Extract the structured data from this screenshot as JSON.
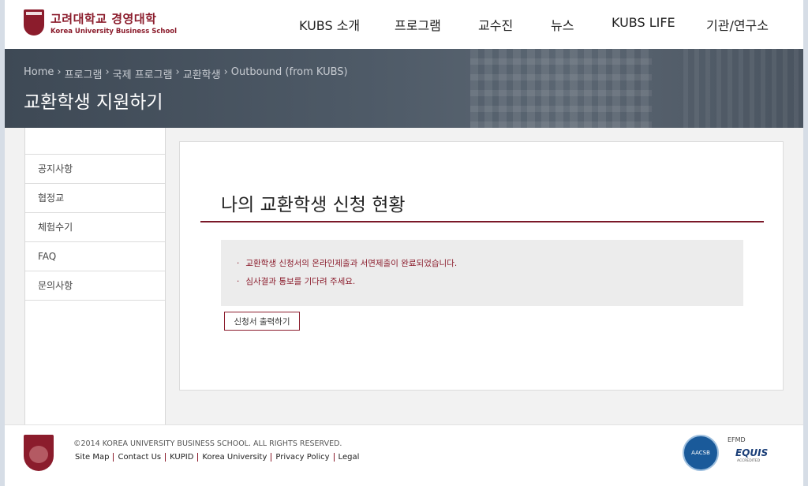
{
  "header": {
    "logo_kr": "고려대학교 경영대학",
    "logo_en": "Korea University Business School",
    "nav": [
      {
        "label": "KUBS 소개"
      },
      {
        "label": "프로그램"
      },
      {
        "label": "교수진"
      },
      {
        "label": "뉴스"
      },
      {
        "label": "KUBS LIFE"
      },
      {
        "label": "기관/연구소"
      }
    ]
  },
  "banner": {
    "breadcrumb": [
      "Home",
      "프로그램",
      "국제 프로그램",
      "교환학생",
      "Outbound (from KUBS)"
    ],
    "title": "교환학생 지원하기"
  },
  "sidebar": {
    "items": [
      {
        "label": "공지사항"
      },
      {
        "label": "협정교"
      },
      {
        "label": "체험수기"
      },
      {
        "label": "FAQ"
      },
      {
        "label": "문의사항"
      }
    ]
  },
  "main": {
    "title": "나의 교환학생 신청 현황",
    "notices": [
      "교환학생 신청서의 온라인제출과 서면제출이 완료되었습니다.",
      "심사결과 통보를 기다려 주세요."
    ],
    "print_button": "신청서 출력하기"
  },
  "footer": {
    "copyright": "©2014 KOREA UNIVERSITY BUSINESS SCHOOL. ALL RIGHTS RESERVED.",
    "links": [
      {
        "label": "Site Map"
      },
      {
        "label": "Contact Us"
      },
      {
        "label": "KUPID"
      },
      {
        "label": "Korea University"
      },
      {
        "label": "Privacy Policy"
      },
      {
        "label": "Legal"
      }
    ],
    "aacsb_label": "AACSB",
    "equis_top": "EFMD",
    "equis_label": "EQUIS",
    "equis_sub": "ACCREDITED"
  },
  "colors": {
    "brand": "#8b1c2c",
    "banner": "#4a5562"
  }
}
